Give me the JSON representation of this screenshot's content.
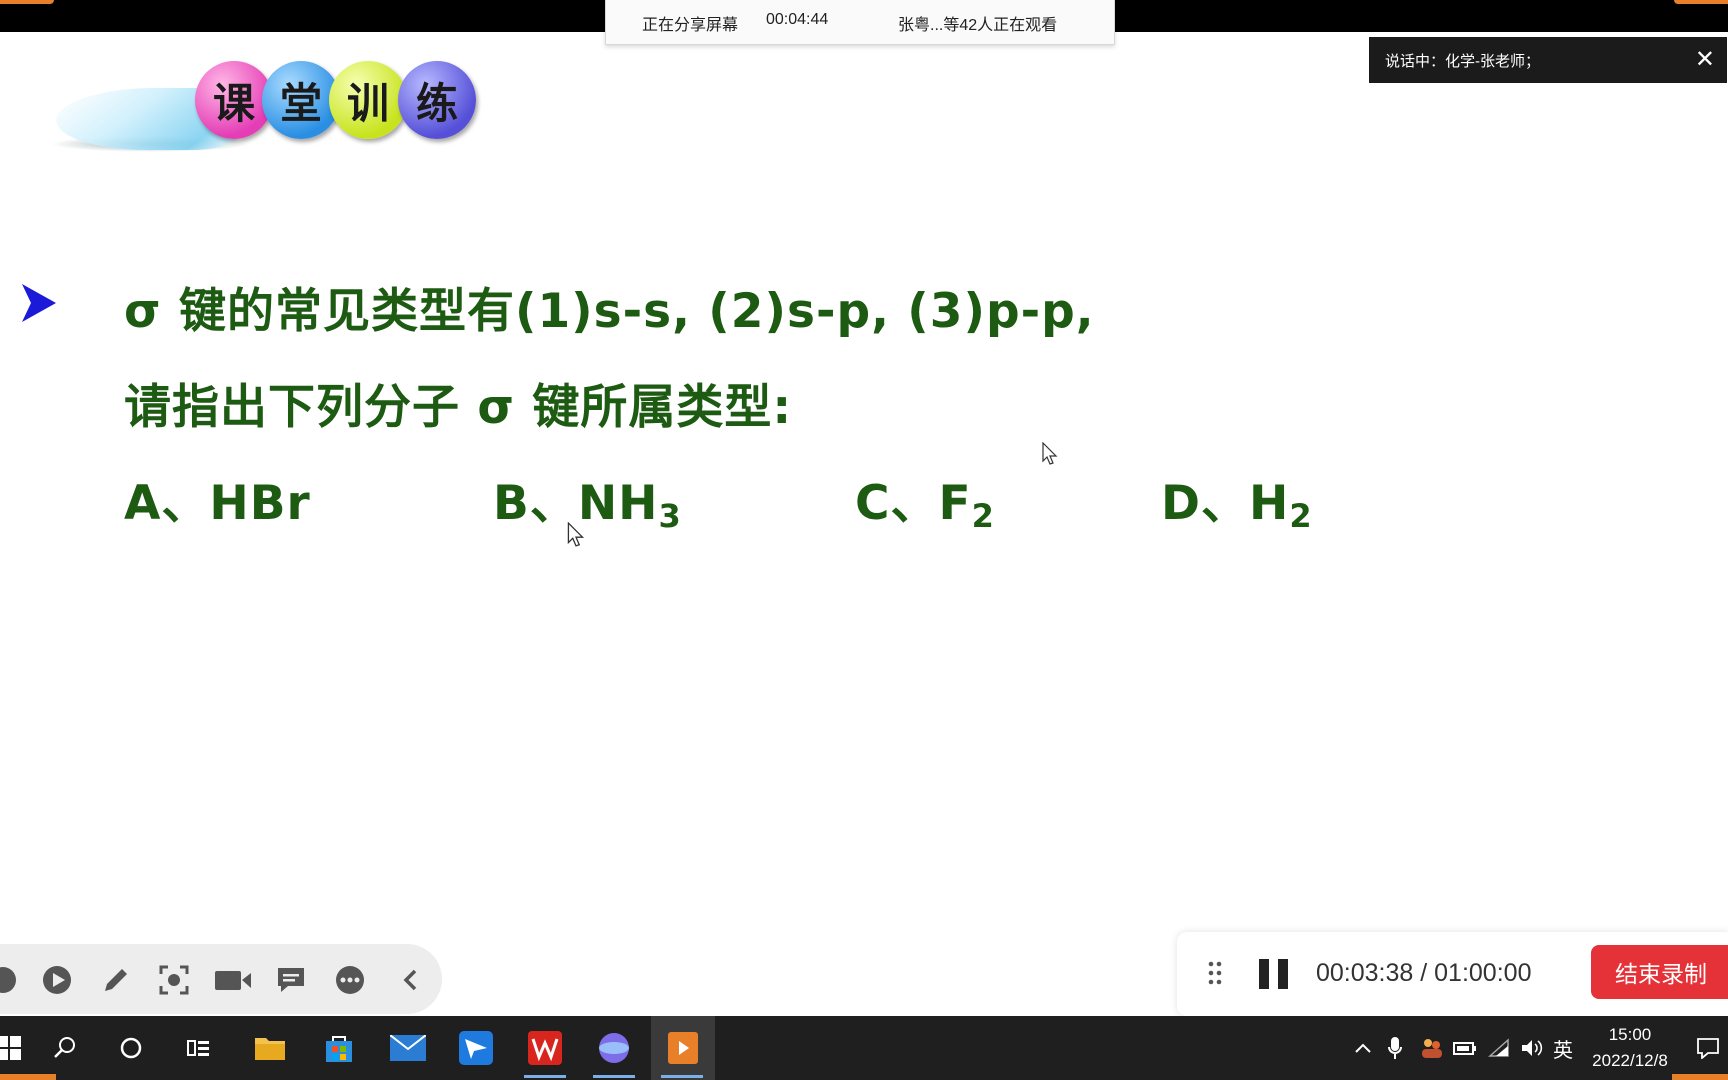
{
  "screen_share": {
    "status_label": "正在分享屏幕",
    "elapsed": "00:04:44",
    "viewers": "张粤...等42人正在观看"
  },
  "speaking": {
    "label": "说话中：化学-张老师；"
  },
  "banner": {
    "chars": [
      "课",
      "堂",
      "训",
      "练"
    ]
  },
  "slide": {
    "line1": "σ 键的常见类型有(1)s-s, (2)s-p, (3)p-p,",
    "line2": "请指出下列分子 σ 键所属类型:",
    "options": [
      {
        "prefix": "A、HBr",
        "sub": ""
      },
      {
        "prefix": "B、NH",
        "sub": "3"
      },
      {
        "prefix": "C、F",
        "sub": "2"
      },
      {
        "prefix": "D、H",
        "sub": "2"
      }
    ]
  },
  "toolbar": {
    "icons": [
      "record-icon",
      "play-icon",
      "pen-icon",
      "screenshot-icon",
      "camera-icon",
      "chat-icon",
      "more-icon",
      "collapse-icon"
    ]
  },
  "recording": {
    "timer": "00:03:38 / 01:00:00",
    "end_label": "结束录制",
    "end_color": "#e53138"
  },
  "taskbar": {
    "ime": "英",
    "time": "15:00",
    "date": "2022/12/8"
  }
}
